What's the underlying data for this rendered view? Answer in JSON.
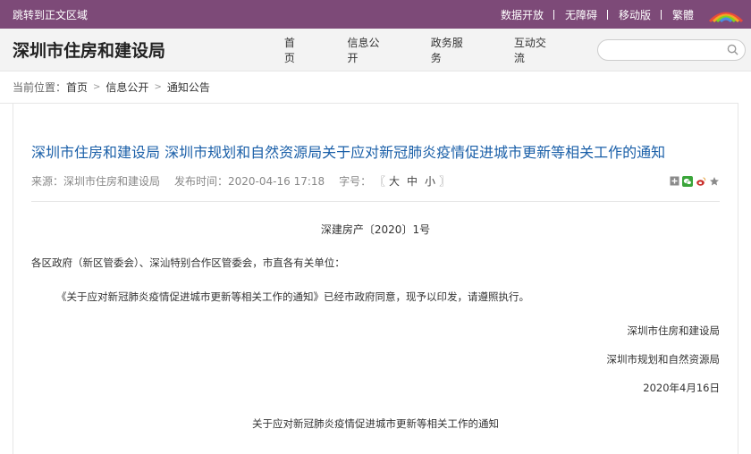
{
  "topbar": {
    "skip": "跳转到正文区域",
    "links": [
      "数据开放",
      "无障碍",
      "移动版",
      "繁體"
    ]
  },
  "header": {
    "title": "深圳市住房和建设局",
    "nav": [
      "首页",
      "信息公开",
      "政务服务",
      "互动交流"
    ],
    "search_placeholder": ""
  },
  "breadcrumb": {
    "prefix": "当前位置：",
    "items": [
      "首页",
      "信息公开",
      "通知公告"
    ]
  },
  "article": {
    "title": "深圳市住房和建设局 深圳市规划和自然资源局关于应对新冠肺炎疫情促进城市更新等相关工作的通知",
    "source": "来源：深圳市住房和建设局",
    "publish_time": "发布时间：2020-04-16 17:18",
    "font_size_label": "字号：",
    "font_sizes": [
      "大",
      "中",
      "小"
    ],
    "doc_number": "深建房产〔2020〕1号",
    "salutation": "各区政府（新区管委会）、深汕特别合作区管委会，市直各有关单位：",
    "body": "《关于应对新冠肺炎疫情促进城市更新等相关工作的通知》已经市政府同意，现予以印发，请遵照执行。",
    "signatory_1": "深圳市住房和建设局",
    "signatory_2": "深圳市规划和自然资源局",
    "date": "2020年4月16日",
    "attachment": "关于应对新冠肺炎疫情促进城市更新等相关工作的通知"
  }
}
